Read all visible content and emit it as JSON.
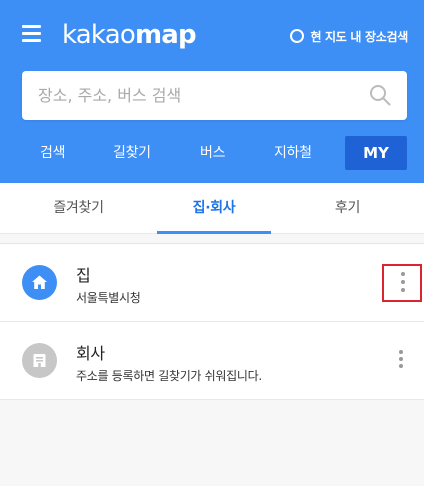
{
  "header": {
    "logo_light": "kakao",
    "logo_bold": "map",
    "toggle_label": "현 지도 내 장소검색"
  },
  "search": {
    "placeholder": "장소, 주소, 버스 검색"
  },
  "nav": {
    "items": [
      "검색",
      "길찾기",
      "버스",
      "지하철"
    ],
    "my_label": "MY"
  },
  "tabs": {
    "items": [
      "즐겨찾기",
      "집·회사",
      "후기"
    ],
    "active": "집·회사"
  },
  "places": [
    {
      "title": "집",
      "subtitle": "서울특별시청",
      "icon": "home-icon"
    },
    {
      "title": "회사",
      "subtitle": "주소를 등록하면 길찾기가 쉬워집니다.",
      "icon": "office-icon"
    }
  ],
  "colors": {
    "brand_blue": "#3d8ef5",
    "my_button": "#1f62d6",
    "active_tab_text": "#1f74e8",
    "highlight_border": "#d9262e"
  }
}
